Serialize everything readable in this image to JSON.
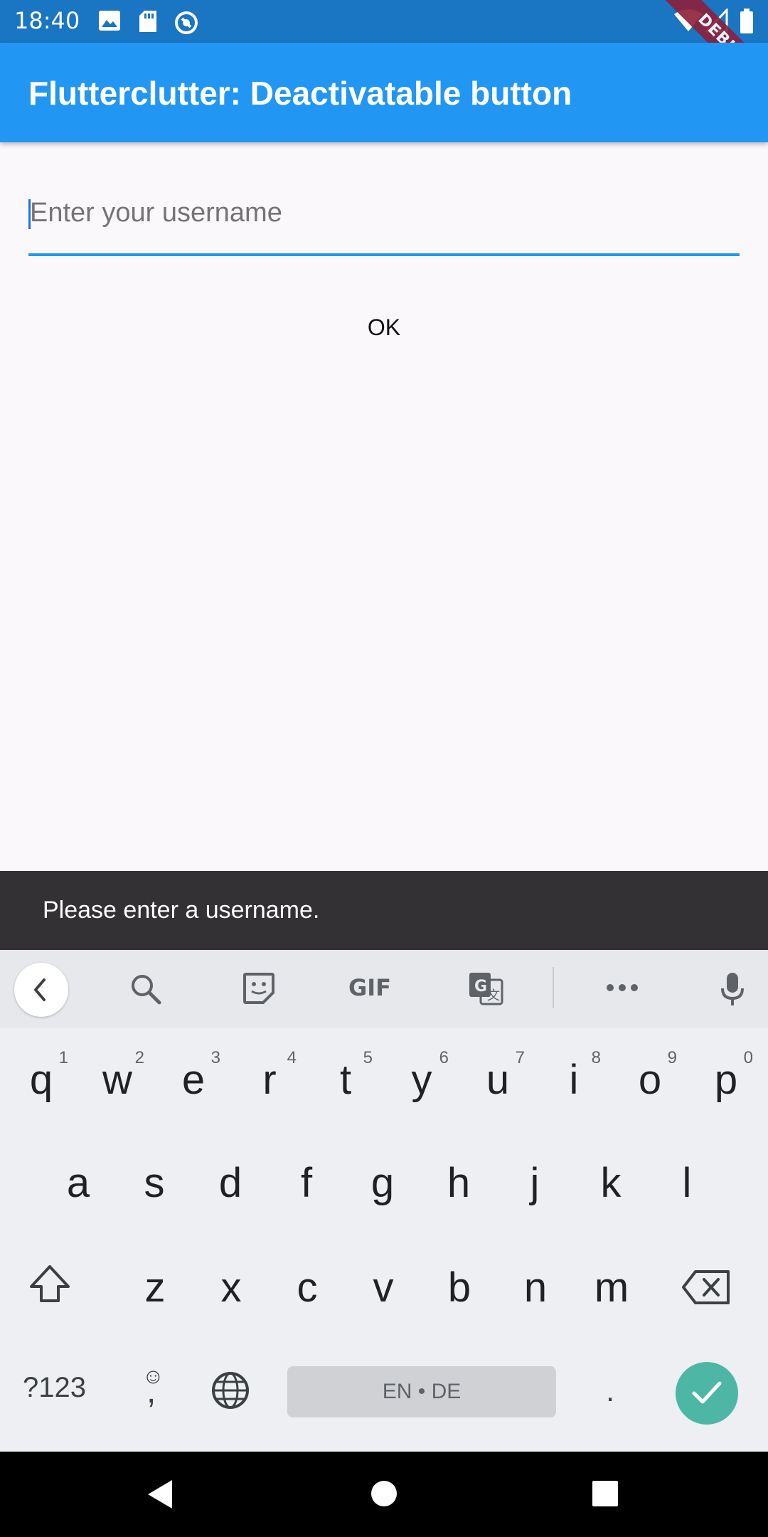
{
  "status_bar": {
    "time": "18:40",
    "left_icons": [
      "image-icon",
      "sd-card-icon",
      "sync-icon"
    ],
    "right_icons": [
      "wifi-icon",
      "signal-icon",
      "battery-icon"
    ]
  },
  "debug_banner": "DEBUG",
  "app_bar": {
    "title": "Flutterclutter: Deactivatable button"
  },
  "form": {
    "username_placeholder": "Enter your username",
    "ok_label": "OK"
  },
  "snackbar": {
    "message": "Please enter a username."
  },
  "keyboard": {
    "toolbar_icons": [
      "back-icon",
      "search-icon",
      "sticker-icon",
      "gif-icon",
      "translate-icon",
      "more-icon",
      "mic-icon"
    ],
    "gif_label": "GIF",
    "row1": [
      {
        "key": "q",
        "hint": "1"
      },
      {
        "key": "w",
        "hint": "2"
      },
      {
        "key": "e",
        "hint": "3"
      },
      {
        "key": "r",
        "hint": "4"
      },
      {
        "key": "t",
        "hint": "5"
      },
      {
        "key": "y",
        "hint": "6"
      },
      {
        "key": "u",
        "hint": "7"
      },
      {
        "key": "i",
        "hint": "8"
      },
      {
        "key": "o",
        "hint": "9"
      },
      {
        "key": "p",
        "hint": "0"
      }
    ],
    "row2": [
      "a",
      "s",
      "d",
      "f",
      "g",
      "h",
      "j",
      "k",
      "l"
    ],
    "row3": [
      "z",
      "x",
      "c",
      "v",
      "b",
      "n",
      "m"
    ],
    "symbols_label": "?123",
    "comma_label": ",",
    "emoji_hint": "☺",
    "space_label": "EN • DE",
    "period_label": "."
  },
  "nav_bar": {
    "icons": [
      "back-triangle-icon",
      "home-circle-icon",
      "recents-square-icon"
    ]
  }
}
